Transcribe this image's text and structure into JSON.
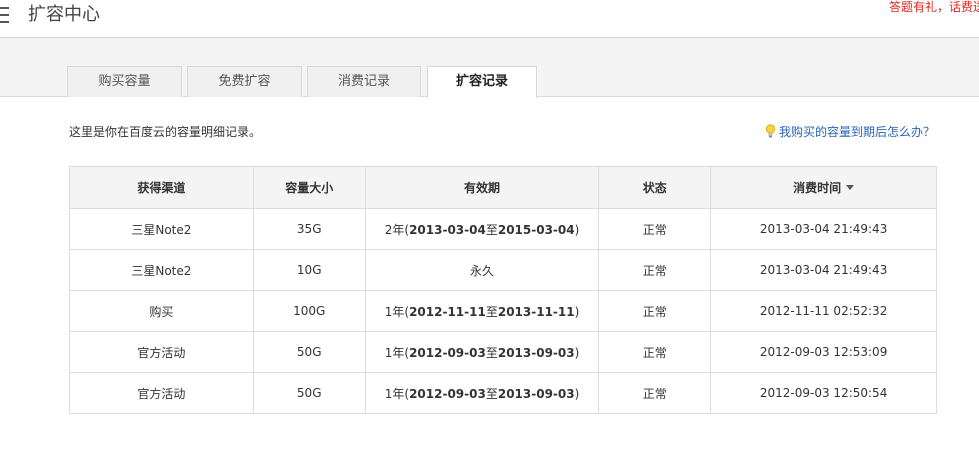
{
  "header": {
    "title": "扩容中心",
    "promo": "答题有礼，话费送"
  },
  "tabs": [
    {
      "label": "购买容量"
    },
    {
      "label": "免费扩容"
    },
    {
      "label": "消费记录"
    },
    {
      "label": "扩容记录",
      "active": true
    }
  ],
  "content": {
    "description": "这里是你在百度云的容量明细记录。",
    "help_link": "我购买的容量到期后怎么办？"
  },
  "table": {
    "headers": [
      "获得渠道",
      "容量大小",
      "有效期",
      "状态",
      "消费时间"
    ],
    "rows": [
      {
        "channel": "三星Note2",
        "size": "35G",
        "period_prefix": "2年(",
        "start": "2013-03-04",
        "to": "至",
        "end": "2015-03-04",
        "suffix": ")",
        "status": "正常",
        "time": "2013-03-04 21:49:43"
      },
      {
        "channel": "三星Note2",
        "size": "10G",
        "period": "永久",
        "status": "正常",
        "time": "2013-03-04 21:49:43"
      },
      {
        "channel": "购买",
        "size": "100G",
        "period_prefix": "1年(",
        "start": "2012-11-11",
        "to": "至",
        "end": "2013-11-11",
        "suffix": ")",
        "status": "正常",
        "time": "2012-11-11 02:52:32"
      },
      {
        "channel": "官方活动",
        "size": "50G",
        "period_prefix": "1年(",
        "start": "2012-09-03",
        "to": "至",
        "end": "2013-09-03",
        "suffix": ")",
        "status": "正常",
        "time": "2012-09-03 12:53:09"
      },
      {
        "channel": "官方活动",
        "size": "50G",
        "period_prefix": "1年(",
        "start": "2012-09-03",
        "to": "至",
        "end": "2013-09-03",
        "suffix": ")",
        "status": "正常",
        "time": "2012-09-03 12:50:54"
      }
    ]
  },
  "icons": {
    "menu": "menu-icon",
    "bulb": "lightbulb-icon",
    "sort": "sort-desc-icon"
  },
  "colors": {
    "promo": "#e0261d",
    "link": "#2a63b8"
  }
}
